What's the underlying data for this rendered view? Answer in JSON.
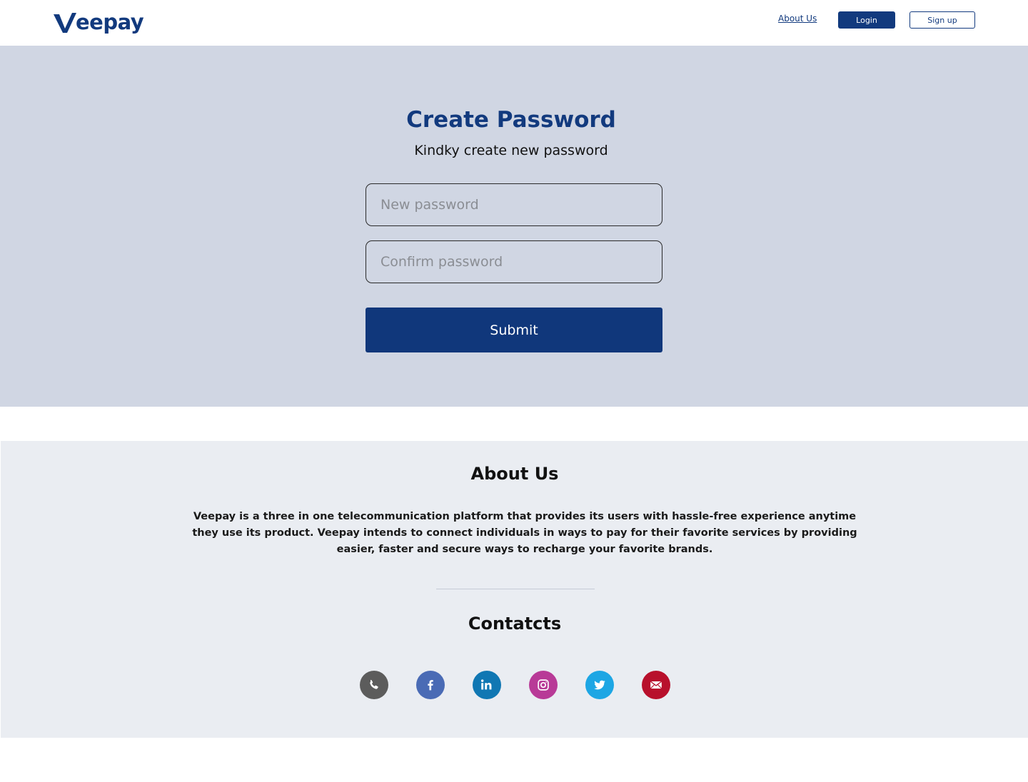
{
  "header": {
    "brand": "eepay",
    "nav": {
      "about_label": "About Us",
      "login_label": "Login",
      "signup_label": "Sign up"
    }
  },
  "hero": {
    "title": "Create Password",
    "subtitle": "Kindky create new password",
    "new_password": {
      "value": "",
      "placeholder": "New password"
    },
    "confirm_password": {
      "value": "",
      "placeholder": "Confirm password"
    },
    "submit_label": "Submit"
  },
  "about": {
    "title": "About Us",
    "text": "Veepay is a three in one telecommunication platform that provides its users with hassle-free experience anytime they use its product. Veepay intends to connect individuals in ways to pay for their favorite services by providing easier, faster and secure ways to recharge your favorite brands.",
    "contacts_title": "Contatcts",
    "socials": [
      {
        "icon": "phone-icon",
        "color": "#5c5c5c"
      },
      {
        "icon": "facebook-icon",
        "color": "#4a6bb5"
      },
      {
        "icon": "linkedin-icon",
        "color": "#1077b3"
      },
      {
        "icon": "instagram-icon",
        "color": "#b83a97"
      },
      {
        "icon": "twitter-icon",
        "color": "#1da6e4"
      },
      {
        "icon": "email-icon",
        "color": "#b8102c"
      }
    ]
  },
  "colors": {
    "brand": "#123a7e",
    "hero_bg": "#d0d6e3",
    "about_bg": "#eaedf2"
  }
}
